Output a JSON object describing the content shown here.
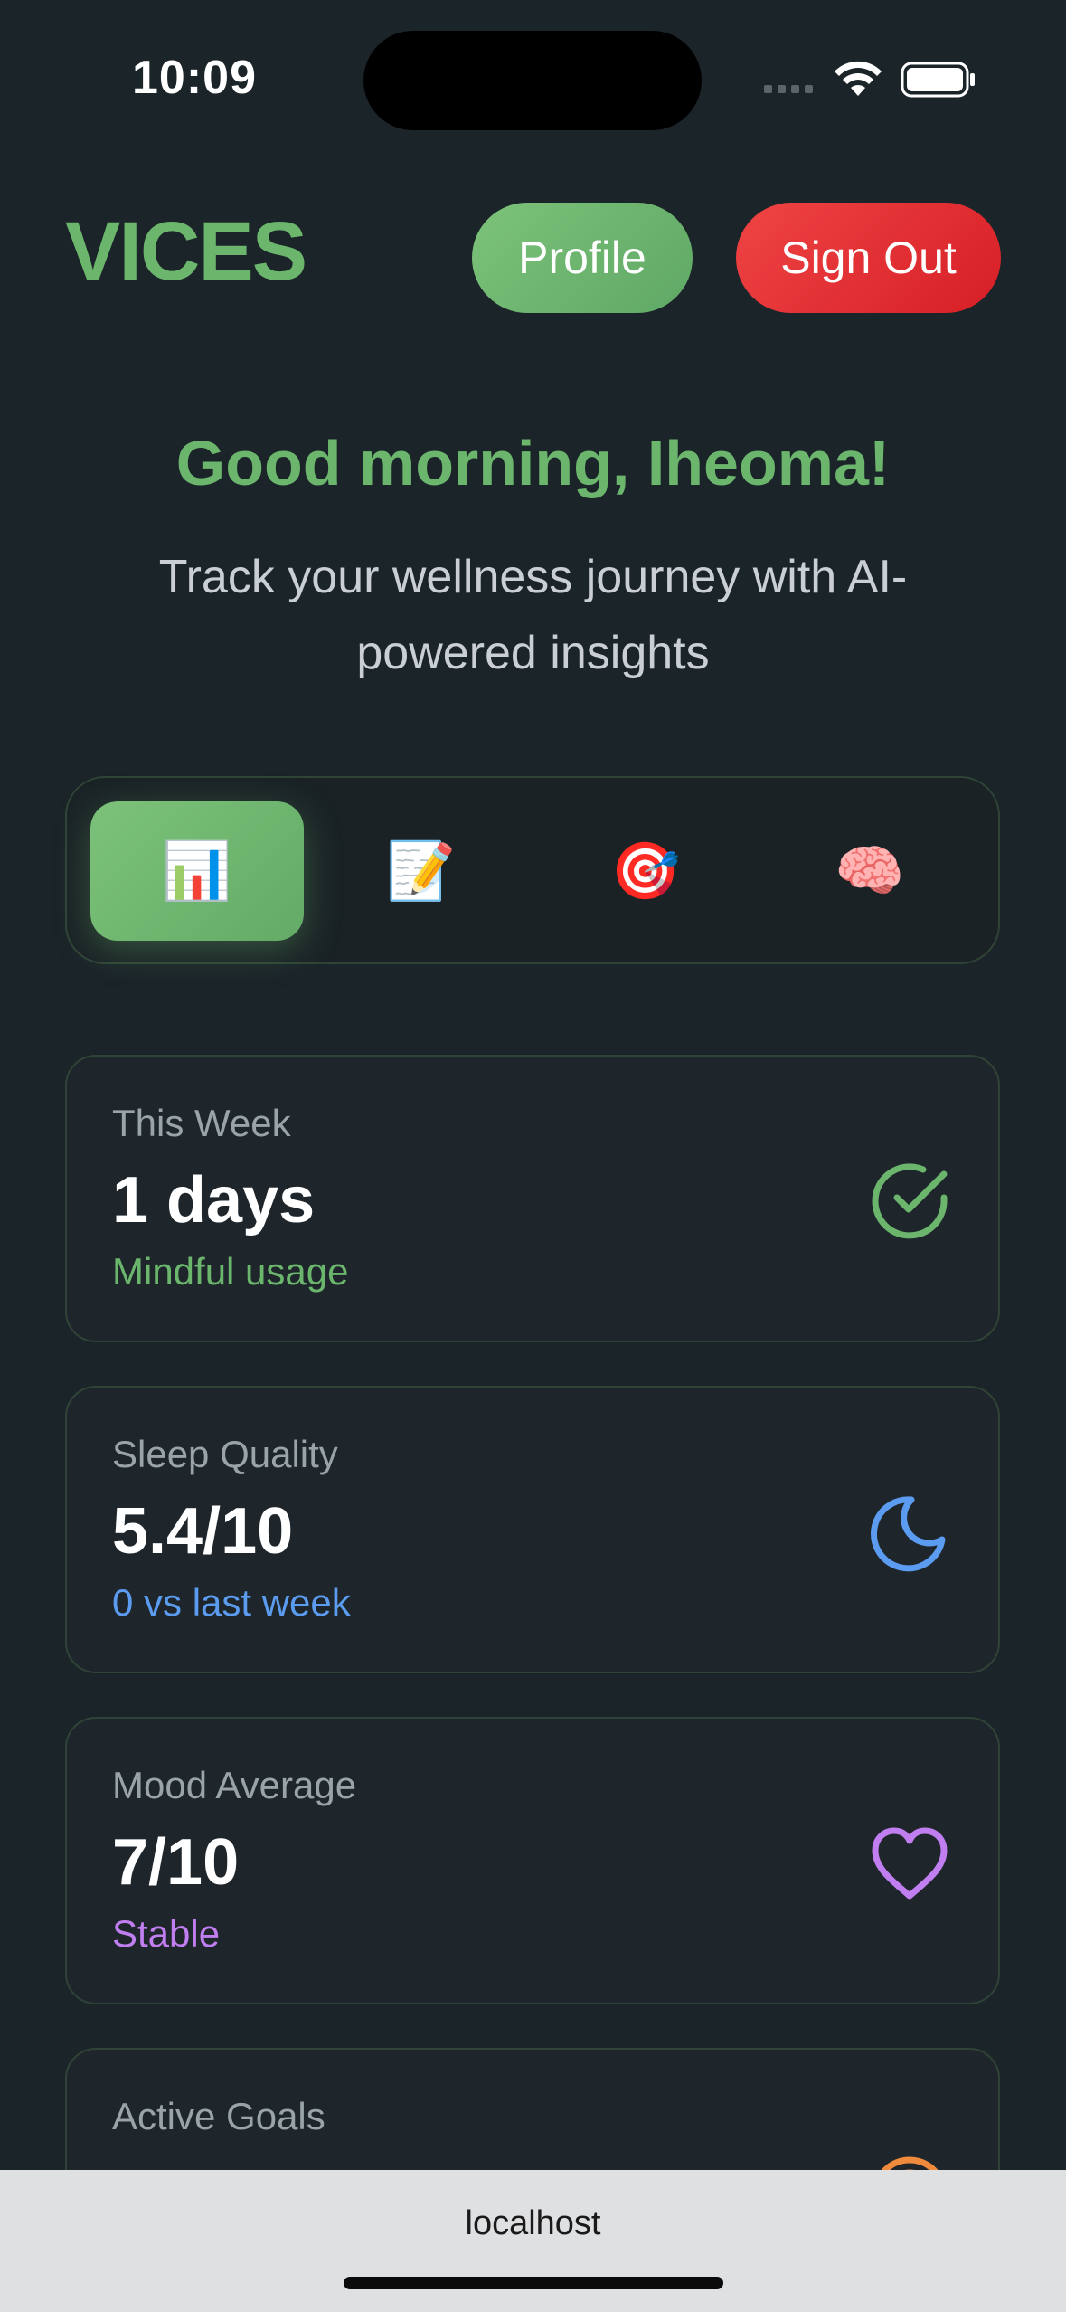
{
  "status_bar": {
    "time": "10:09"
  },
  "header": {
    "logo": "VICES",
    "profile_label": "Profile",
    "signout_label": "Sign Out"
  },
  "hero": {
    "greeting": "Good morning, Iheoma!",
    "subtitle": "Track your wellness journey with AI-powered insights"
  },
  "tabs": [
    {
      "icon": "📊",
      "icon_name": "bar-chart-icon",
      "active": true
    },
    {
      "icon": "📝",
      "icon_name": "memo-icon",
      "active": false
    },
    {
      "icon": "🎯",
      "icon_name": "target-icon",
      "active": false
    },
    {
      "icon": "🧠",
      "icon_name": "brain-icon",
      "active": false
    }
  ],
  "stats": [
    {
      "label": "This Week",
      "value": "1 days",
      "sub": "Mindful usage",
      "sub_color": "#6bb56c",
      "icon_name": "check-circle-icon"
    },
    {
      "label": "Sleep Quality",
      "value": "5.4/10",
      "sub": "0 vs last week",
      "sub_color": "#5b9cf0",
      "icon_name": "moon-icon"
    },
    {
      "label": "Mood Average",
      "value": "7/10",
      "sub": "Stable",
      "sub_color": "#c17ef0",
      "icon_name": "heart-icon"
    },
    {
      "label": "Active Goals",
      "value": "",
      "sub": "",
      "sub_color": "#f08a3c",
      "icon_name": "target-icon"
    }
  ],
  "browser": {
    "url": "localhost"
  },
  "colors": {
    "background": "#1b2429",
    "brand_green": "#6bb56c",
    "danger_red": "#e5262e",
    "sleep_blue": "#5b9cf0",
    "mood_purple": "#c17ef0",
    "goals_orange": "#f08a3c"
  }
}
